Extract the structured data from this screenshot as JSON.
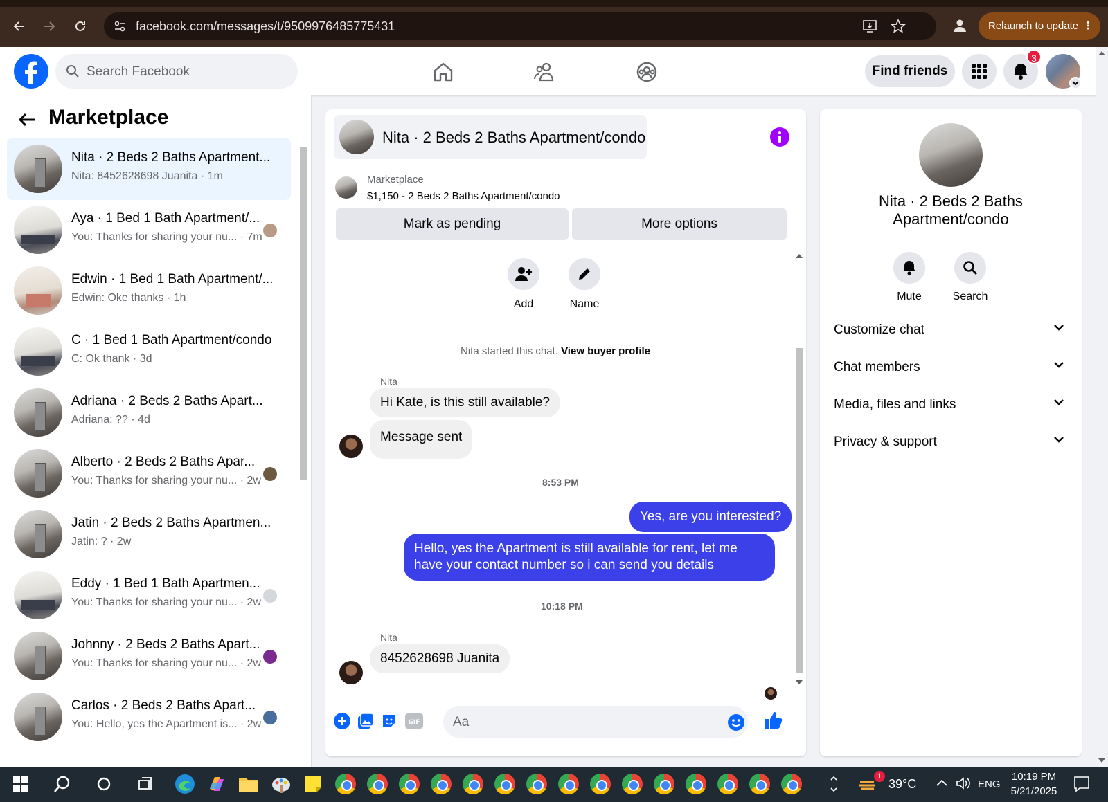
{
  "browser": {
    "url": "facebook.com/messages/t/9509976485775431",
    "relaunch_label": "Relaunch to update"
  },
  "header": {
    "search_placeholder": "Search Facebook",
    "find_friends_label": "Find friends",
    "notification_count": "3"
  },
  "sidebar": {
    "title": "Marketplace",
    "conversations": [
      {
        "title": "Nita · 2 Beds 2 Baths Apartment...",
        "snippet": "Nita: 8452628698 Juanita · 1m",
        "active": true
      },
      {
        "title": "Aya · 1 Bed 1 Bath Apartment/...",
        "snippet": "You: Thanks for sharing your nu... · 7m"
      },
      {
        "title": "Edwin · 1 Bed 1 Bath Apartment/...",
        "snippet": "Edwin: Oke thanks · 1h"
      },
      {
        "title": "C · 1 Bed 1 Bath Apartment/condo",
        "snippet": "C: Ok thank · 3d"
      },
      {
        "title": "Adriana · 2 Beds 2 Baths Apart...",
        "snippet": "Adriana: ?? · 4d"
      },
      {
        "title": "Alberto · 2 Beds 2 Baths Apar...",
        "snippet": "You: Thanks for sharing your nu... · 2w"
      },
      {
        "title": "Jatin · 2 Beds 2 Baths Apartmen...",
        "snippet": "Jatin: ? · 2w"
      },
      {
        "title": "Eddy · 1 Bed 1 Bath Apartmen...",
        "snippet": "You: Thanks for sharing your nu... · 2w"
      },
      {
        "title": "Johnny · 2 Beds 2 Baths Apart...",
        "snippet": "You: Thanks for sharing your nu... · 2w"
      },
      {
        "title": "Carlos · 2 Beds 2 Baths Apart...",
        "snippet": "You: Hello, yes the Apartment is... · 2w"
      }
    ]
  },
  "chat": {
    "title": "Nita · 2 Beds 2 Baths Apartment/condo",
    "marketplace_label": "Marketplace",
    "listing": "$1,150 - 2 Beds 2 Baths Apartment/condo",
    "mark_pending_label": "Mark as pending",
    "more_options_label": "More options",
    "add_label": "Add",
    "name_label": "Name",
    "started_text": "Nita started this chat.",
    "view_profile_label": "View buyer profile",
    "sender_name": "Nita",
    "messages_1": [
      "Hi Kate, is this still available?",
      "Message sent"
    ],
    "time_1": "8:53 PM",
    "outgoing": [
      "Yes, are you interested?",
      "Hello, yes the Apartment is still available for rent, let me have your contact number so i can send you details"
    ],
    "time_2": "10:18 PM",
    "sender_name_2": "Nita",
    "last_message": "8452628698 Juanita",
    "input_placeholder": "Aa"
  },
  "info": {
    "name": "Nita · 2 Beds 2 Baths Apartment/condo",
    "mute_label": "Mute",
    "search_label": "Search",
    "sections": [
      "Customize chat",
      "Chat members",
      "Media, files and links",
      "Privacy & support"
    ]
  },
  "taskbar": {
    "temperature": "39°C",
    "language": "ENG",
    "time": "10:19 PM",
    "date": "5/21/2025",
    "weather_badge": "1"
  }
}
